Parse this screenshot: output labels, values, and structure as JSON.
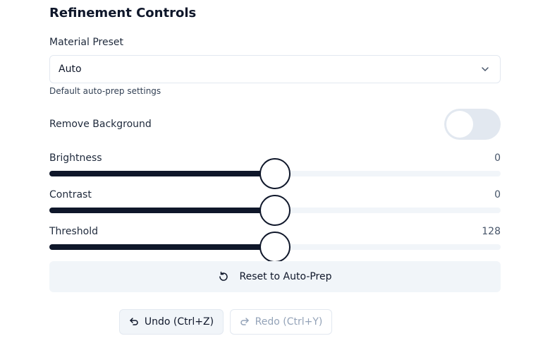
{
  "section": {
    "title": "Refinement Controls"
  },
  "material_preset": {
    "label": "Material Preset",
    "selected": "Auto",
    "hint": "Default auto-prep settings"
  },
  "remove_background": {
    "label": "Remove Background",
    "enabled": false
  },
  "sliders": [
    {
      "label": "Brightness",
      "value": "0",
      "fraction": 0.5
    },
    {
      "label": "Contrast",
      "value": "0",
      "fraction": 0.5
    },
    {
      "label": "Threshold",
      "value": "128",
      "fraction": 0.5
    }
  ],
  "actions": {
    "reset_label": "Reset to Auto-Prep",
    "undo_label": "Undo (Ctrl+Z)",
    "redo_label": "Redo (Ctrl+Y)",
    "redo_disabled": true
  },
  "icons": {
    "select_chevron": "chevron-down-icon",
    "reset": "rotate-ccw-icon",
    "undo": "undo-icon",
    "redo": "redo-icon"
  }
}
